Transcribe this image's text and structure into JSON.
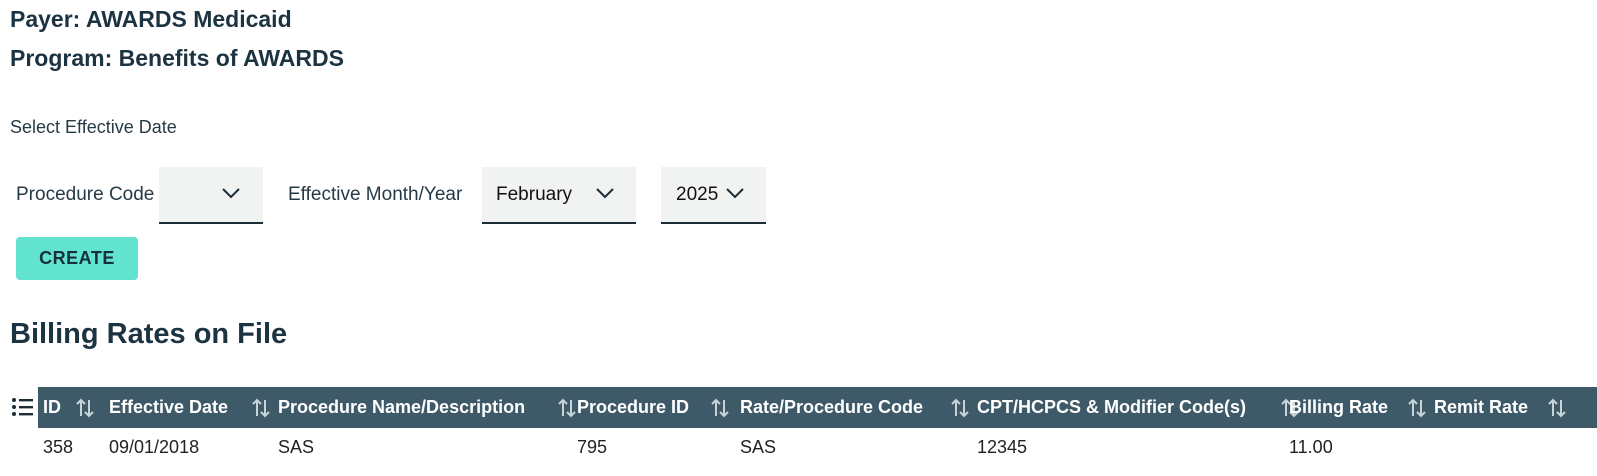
{
  "header": {
    "payer": "Payer: AWARDS Medicaid",
    "program": "Program: Benefits of AWARDS"
  },
  "form": {
    "select_label": "Select Effective Date",
    "procedure_code_label": "Procedure Code",
    "procedure_code_value": "",
    "effective_label": "Effective Month/Year",
    "month_value": "February",
    "year_value": "2025",
    "create_label": "CREATE"
  },
  "section": {
    "title": "Billing Rates on File"
  },
  "table": {
    "columns": [
      "ID",
      "Effective Date",
      "Procedure Name/Description",
      "Procedure ID",
      "Rate/Procedure Code",
      "CPT/HCPCS & Modifier Code(s)",
      "Billing Rate",
      "Remit Rate"
    ],
    "rows": [
      [
        "358",
        "09/01/2018",
        "SAS",
        "795",
        "SAS",
        "12345",
        "11.00",
        ""
      ]
    ]
  },
  "colors": {
    "accent_button": "#62e3cf",
    "table_header": "#3e5a68",
    "heading_text": "#1c3342"
  },
  "icons": {
    "dropdown": "chevron-down-icon",
    "sort": "sort-arrows-icon",
    "columns": "list-icon"
  }
}
